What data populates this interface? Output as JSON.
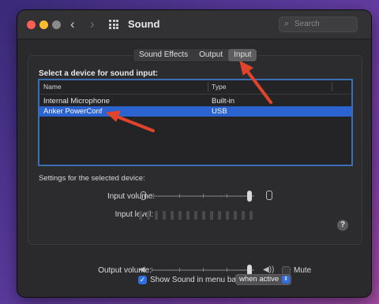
{
  "window": {
    "title": "Sound",
    "search_placeholder": "Search"
  },
  "tabs": [
    {
      "label": "Sound Effects",
      "active": false
    },
    {
      "label": "Output",
      "active": false
    },
    {
      "label": "Input",
      "active": true
    }
  ],
  "input": {
    "heading": "Select a device for sound input:",
    "columns": [
      "Name",
      "Type"
    ],
    "devices": [
      {
        "name": "Internal Microphone",
        "type": "Built-in",
        "selected": false
      },
      {
        "name": "Anker PowerConf",
        "type": "USB",
        "selected": true
      }
    ],
    "settings_label": "Settings for the selected device:",
    "input_volume_label": "Input volume:",
    "input_volume_level": 0.95,
    "input_level_label": "Input level:",
    "input_level_segments": 15
  },
  "output": {
    "output_volume_label": "Output volume:",
    "output_volume_level": 0.95,
    "mute_label": "Mute",
    "mute_checked": false,
    "show_in_menu_bar_label": "Show Sound in menu bar",
    "show_in_menu_bar_checked": true,
    "menu_bar_option": "when active"
  },
  "colors": {
    "selection": "#2b63d1",
    "annotation_arrow": "#e0442b"
  },
  "icons": [
    "back-icon",
    "forward-icon",
    "grid-icon",
    "search-icon",
    "microphone-icon",
    "speaker-icon",
    "help-icon",
    "chevron-updown-icon",
    "checkmark-icon"
  ]
}
